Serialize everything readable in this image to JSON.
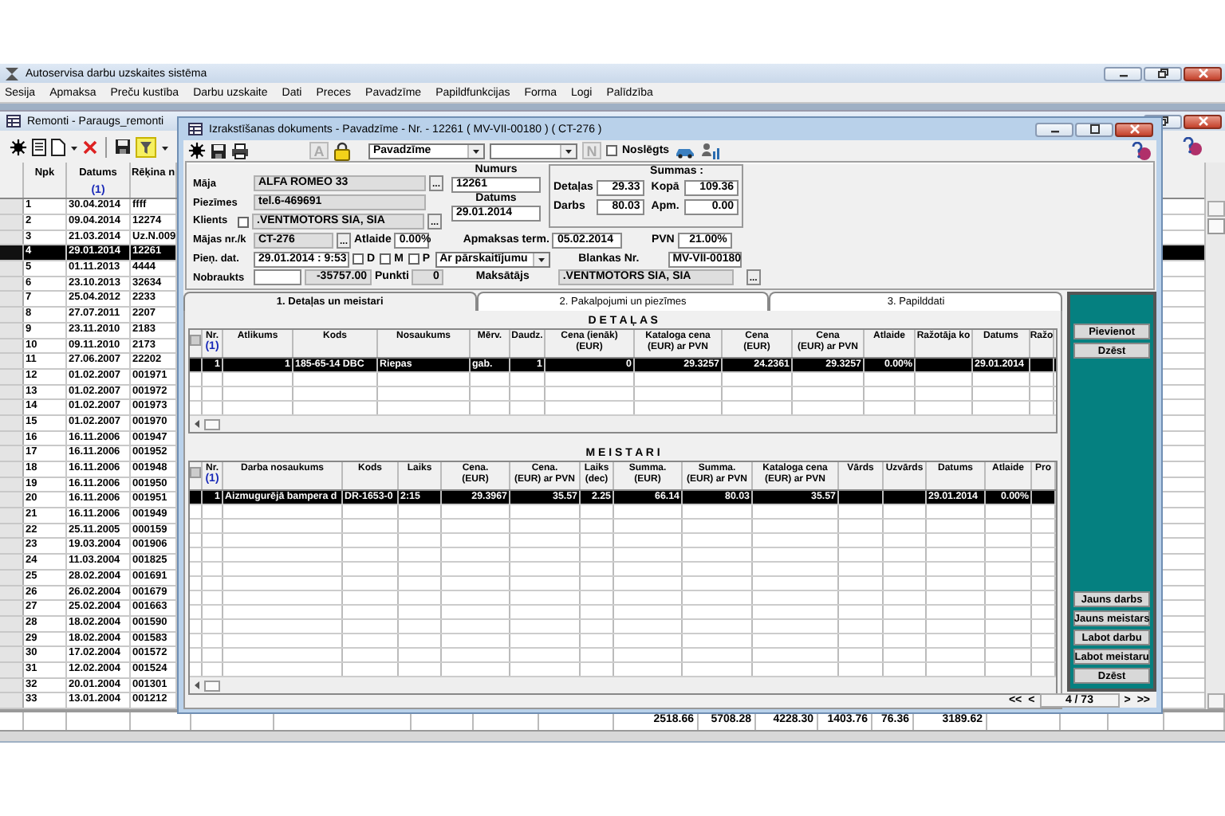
{
  "app": {
    "title": "Autoservisa darbu uzskaites sistēma",
    "menu": [
      "Sesija",
      "Apmaksa",
      "Preču kustība",
      "Darbu uzskaite",
      "Dati",
      "Preces",
      "Pavadzīme",
      "Papildfunkcijas",
      "Forma",
      "Logi",
      "Palīdzība"
    ]
  },
  "list_window": {
    "title": "Remonti - Paraugs_remonti",
    "columns": [
      {
        "label": "Npk"
      },
      {
        "label": "Datums",
        "sort": "(1)"
      },
      {
        "label": "Rēķina n"
      }
    ],
    "rows": [
      {
        "cells": [
          "1",
          "30.04.2014",
          "ffff"
        ],
        "selected": false
      },
      {
        "cells": [
          "2",
          "09.04.2014",
          "12274"
        ],
        "selected": false
      },
      {
        "cells": [
          "3",
          "21.03.2014",
          "Uz.N.009"
        ],
        "selected": false
      },
      {
        "cells": [
          "4",
          "29.01.2014",
          "12261"
        ],
        "selected": true
      },
      {
        "cells": [
          "5",
          "01.11.2013",
          "4444"
        ],
        "selected": false
      },
      {
        "cells": [
          "6",
          "23.10.2013",
          "32634"
        ],
        "selected": false
      },
      {
        "cells": [
          "7",
          "25.04.2012",
          "2233"
        ],
        "selected": false
      },
      {
        "cells": [
          "8",
          "27.07.2011",
          "2207"
        ],
        "selected": false
      },
      {
        "cells": [
          "9",
          "23.11.2010",
          "2183"
        ],
        "selected": false
      },
      {
        "cells": [
          "10",
          "09.11.2010",
          "2173"
        ],
        "selected": false
      },
      {
        "cells": [
          "11",
          "27.06.2007",
          "22202"
        ],
        "selected": false
      },
      {
        "cells": [
          "12",
          "01.02.2007",
          "001971"
        ],
        "selected": false
      },
      {
        "cells": [
          "13",
          "01.02.2007",
          "001972"
        ],
        "selected": false
      },
      {
        "cells": [
          "14",
          "01.02.2007",
          "001973"
        ],
        "selected": false
      },
      {
        "cells": [
          "15",
          "01.02.2007",
          "001970"
        ],
        "selected": false
      },
      {
        "cells": [
          "16",
          "16.11.2006",
          "001947"
        ],
        "selected": false
      },
      {
        "cells": [
          "17",
          "16.11.2006",
          "001952"
        ],
        "selected": false
      },
      {
        "cells": [
          "18",
          "16.11.2006",
          "001948"
        ],
        "selected": false
      },
      {
        "cells": [
          "19",
          "16.11.2006",
          "001950"
        ],
        "selected": false
      },
      {
        "cells": [
          "20",
          "16.11.2006",
          "001951"
        ],
        "selected": false
      },
      {
        "cells": [
          "21",
          "16.11.2006",
          "001949"
        ],
        "selected": false
      },
      {
        "cells": [
          "22",
          "25.11.2005",
          "000159"
        ],
        "selected": false
      },
      {
        "cells": [
          "23",
          "19.03.2004",
          "001906"
        ],
        "selected": false
      },
      {
        "cells": [
          "24",
          "11.03.2004",
          "001825"
        ],
        "selected": false
      },
      {
        "cells": [
          "25",
          "28.02.2004",
          "001691"
        ],
        "selected": false
      },
      {
        "cells": [
          "26",
          "26.02.2004",
          "001679"
        ],
        "selected": false
      },
      {
        "cells": [
          "27",
          "25.02.2004",
          "001663"
        ],
        "selected": false
      },
      {
        "cells": [
          "28",
          "18.02.2004",
          "001590"
        ],
        "selected": false
      },
      {
        "cells": [
          "29",
          "18.02.2004",
          "001583"
        ],
        "selected": false
      },
      {
        "cells": [
          "30",
          "17.02.2004",
          "001572"
        ],
        "selected": false
      },
      {
        "cells": [
          "31",
          "12.02.2004",
          "001524"
        ],
        "selected": false
      },
      {
        "cells": [
          "32",
          "20.01.2004",
          "001301"
        ],
        "selected": false
      },
      {
        "cells": [
          "33",
          "13.01.2004",
          "001212"
        ],
        "selected": false
      }
    ],
    "totals": [
      "2518.66",
      "5708.28",
      "4228.30",
      "1403.76",
      "76.36",
      "3189.62"
    ]
  },
  "document": {
    "title": "Izrakstīšanas dokuments - Pavadzīme - Nr. - 12261 ( MV-VII-00180 ) ( CT-276 )",
    "font_button": {
      "label": "A",
      "disabled": true
    },
    "doc_type": {
      "value": "Pavadzīme"
    },
    "n_button": {
      "label": "N",
      "disabled": true
    },
    "closed": {
      "label": "Noslēgts",
      "checked": false
    },
    "form": {
      "house": {
        "label": "Māja",
        "value": "ALFA ROMEO 33",
        "readonly": true,
        "button": "..."
      },
      "notes": {
        "label": "Piezīmes",
        "value": "tel.6-469691",
        "readonly": true
      },
      "client": {
        "label": "Klients",
        "checked": false,
        "value": ".VENTMOTORS SIA, SIA",
        "readonly": true,
        "button": "..."
      },
      "house_no": {
        "label": "Mājas nr./k",
        "value": "CT-276",
        "readonly": true,
        "button": "..."
      },
      "discount": {
        "label": "Atlaide",
        "value": "0.00%",
        "readonly": false
      },
      "received": {
        "label": "Pieņ. dat.",
        "value": "29.01.2014 : 9:53",
        "readonly": false
      },
      "flags": [
        {
          "label": "D",
          "checked": false
        },
        {
          "label": "M",
          "checked": false
        },
        {
          "label": "P",
          "checked": false
        }
      ],
      "payment_method": {
        "value": "Ar pārskaitījumu"
      },
      "mileage": {
        "label": "Nobraukts",
        "readonly": false
      },
      "mileage_diff": {
        "value": "-35757.00",
        "readonly": true
      },
      "points": {
        "label": "Punkti",
        "value": "0",
        "readonly": true
      },
      "number": {
        "label": "Numurs",
        "value": "12261",
        "readonly": false
      },
      "date": {
        "label": "Datums",
        "value": "29.01.2014",
        "readonly": false
      },
      "sums": {
        "title": "Summas :",
        "items": [
          {
            "label": "Detaļas",
            "value": "29.33"
          },
          {
            "label": "Kopā",
            "value": "109.36"
          },
          {
            "label": "Darbs",
            "value": "80.03"
          },
          {
            "label": "Apm.",
            "value": "0.00"
          }
        ]
      },
      "due": {
        "label": "Apmaksas term.",
        "value": "05.02.2014",
        "readonly": false
      },
      "vat": {
        "label": "PVN",
        "value": "21.00%",
        "readonly": false
      },
      "blank_no": {
        "label": "Blankas Nr.",
        "value": "MV-VII-00180",
        "readonly": false
      },
      "payer": {
        "label": "Maksātājs",
        "value": ".VENTMOTORS SIA, SIA",
        "readonly": true,
        "button": "..."
      }
    },
    "tabs": [
      {
        "label": "1. Detaļas un meistari",
        "selected": true
      },
      {
        "label": "2. Pakalpojumi un piezīmes",
        "selected": false
      },
      {
        "label": "3. Papilddati",
        "selected": false
      }
    ],
    "parts": [
      {
        "title": "D E T A Ļ A S",
        "columns": [
          {
            "label": "Nr.",
            "sort": "(1)"
          },
          {
            "label": "Atlikums"
          },
          {
            "label": "Kods"
          },
          {
            "label": "Nosaukums"
          },
          {
            "label": "Mērv."
          },
          {
            "label": "Daudz."
          },
          {
            "label": "Cena (ienāk)\n(EUR)"
          },
          {
            "label": "Kataloga cena\n(EUR) ar PVN"
          },
          {
            "label": "Cena\n(EUR)"
          },
          {
            "label": "Cena\n(EUR) ar PVN"
          },
          {
            "label": "Atlaide"
          },
          {
            "label": "Ražotāja ko"
          },
          {
            "label": "Datums"
          },
          {
            "label": "Ražo"
          }
        ],
        "rows": [
          {
            "cells": [
              "1",
              "1",
              "185-65-14 DBC",
              "Riepas",
              "gab.",
              "1",
              "0",
              "29.3257",
              "24.2361",
              "29.3257",
              "0.00%",
              null,
              "29.01.2014",
              null
            ],
            "selected": true
          }
        ]
      },
      {
        "title": "M E I S T A R I",
        "columns": [
          {
            "label": "Nr.",
            "sort": "(1)"
          },
          {
            "label": "Darba nosaukums"
          },
          {
            "label": "Kods"
          },
          {
            "label": "Laiks"
          },
          {
            "label": "Cena.\n(EUR)"
          },
          {
            "label": "Cena.\n(EUR) ar PVN"
          },
          {
            "label": "Laiks\n(dec)"
          },
          {
            "label": "Summa.\n(EUR)"
          },
          {
            "label": "Summa.\n(EUR) ar PVN"
          },
          {
            "label": "Kataloga cena\n(EUR) ar PVN"
          },
          {
            "label": "Vārds"
          },
          {
            "label": "Uzvārds"
          },
          {
            "label": "Datums"
          },
          {
            "label": "Atlaide"
          },
          {
            "label": "Pro"
          }
        ],
        "rows": [
          {
            "cells": [
              "1",
              "Aizmugurējā bampera d",
              "DR-1653-0",
              "2:15",
              "29.3967",
              "35.57",
              "2.25",
              "66.14",
              "80.03",
              "35.57",
              null,
              null,
              "29.01.2014",
              "0.00%",
              null
            ],
            "selected": true
          }
        ]
      }
    ],
    "side_actions_top": [
      "Pievienot",
      "Dzēst"
    ],
    "side_actions_bottom": [
      "Jauns darbs",
      "Jauns meistars",
      "Labot darbu",
      "Labot meistaru",
      "Dzēst"
    ],
    "pager": {
      "prev": [
        "<<",
        "<"
      ],
      "position": "4 / 73",
      "next": [
        ">",
        ">>"
      ]
    }
  }
}
